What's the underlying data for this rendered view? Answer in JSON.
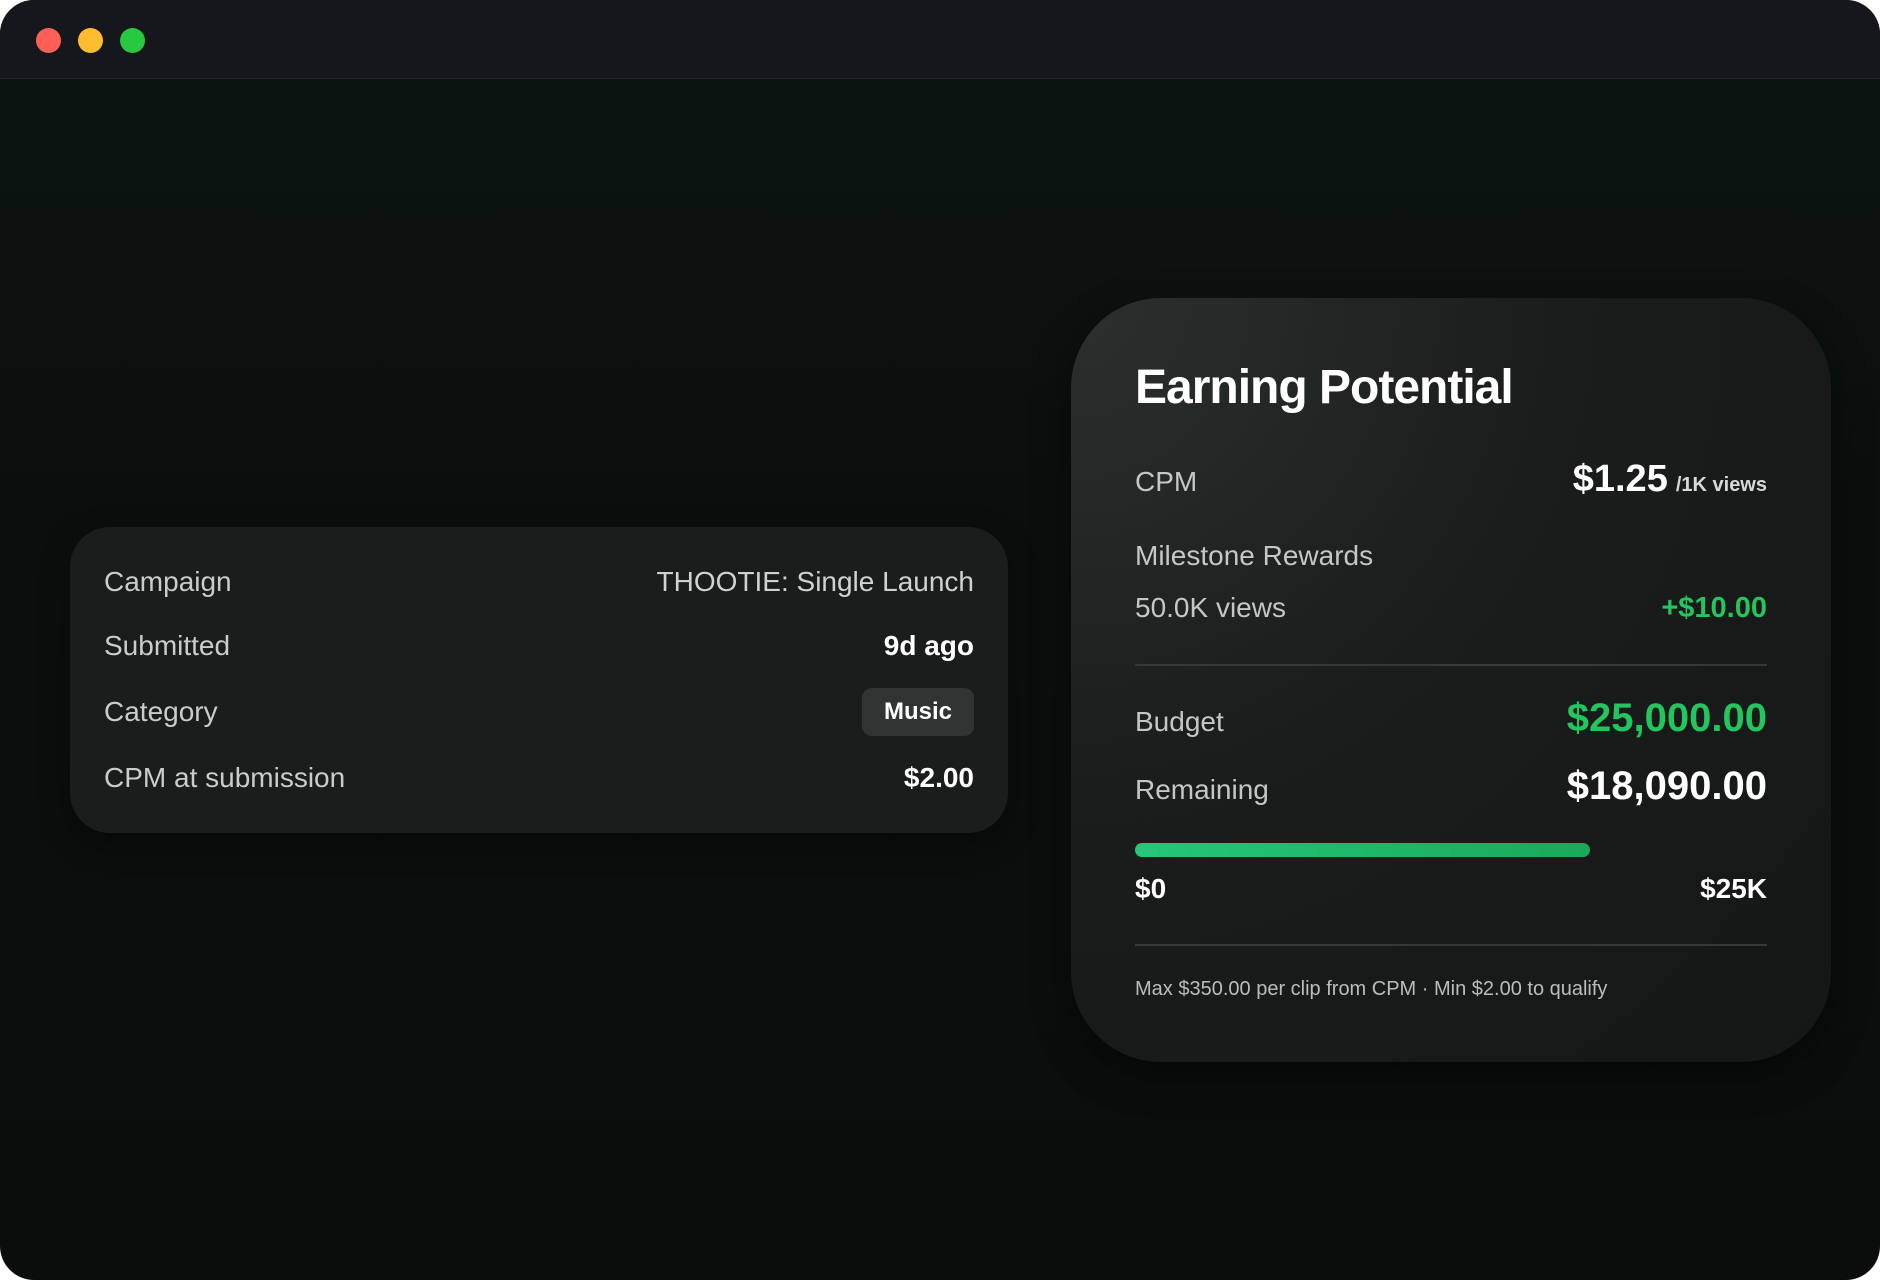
{
  "details": {
    "rows": [
      {
        "label": "Campaign",
        "value": "THOOTIE: Single Launch"
      },
      {
        "label": "Submitted",
        "value": "9d ago"
      },
      {
        "label": "Category",
        "value": "Music"
      },
      {
        "label": "CPM at submission",
        "value": "$2.00"
      }
    ]
  },
  "earning": {
    "title": "Earning Potential",
    "cpm_label": "CPM",
    "cpm_value": "$1.25",
    "cpm_unit": "/1K views",
    "milestone_label": "Milestone Rewards",
    "milestone_threshold": "50.0K views",
    "milestone_reward": "+$10.00",
    "budget_label": "Budget",
    "budget_value": "$25,000.00",
    "remaining_label": "Remaining",
    "remaining_value": "$18,090.00",
    "progress_fraction": 0.72,
    "range_min": "$0",
    "range_max": "$25K",
    "footnote": "Max $350.00 per clip from CPM · Min $2.00 to qualify"
  },
  "colors": {
    "accent_green": "#22c55e",
    "traffic_red": "#fe5f57",
    "traffic_yellow": "#febc2e",
    "traffic_green": "#28c840"
  }
}
